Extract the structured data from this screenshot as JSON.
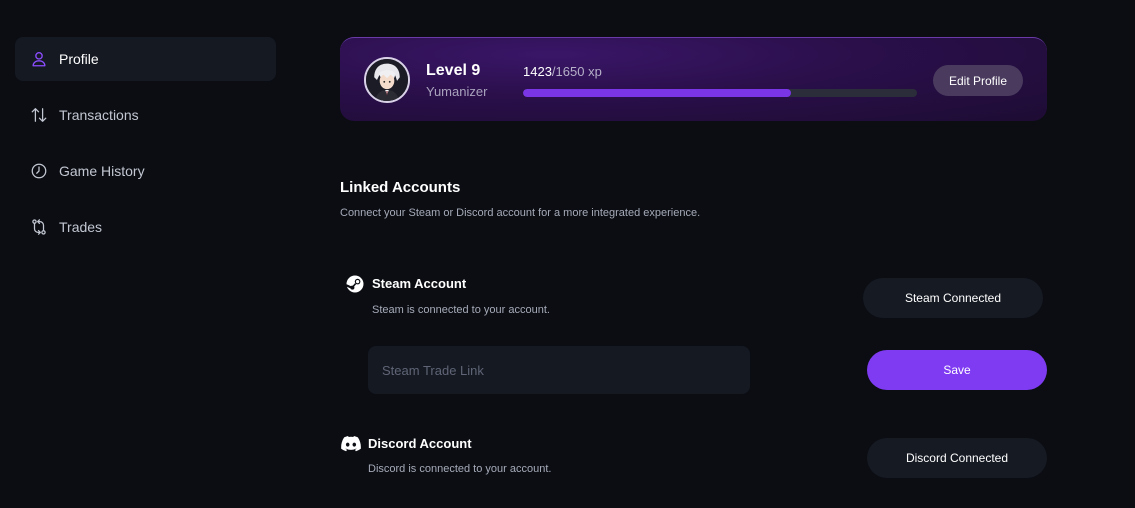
{
  "sidebar": {
    "items": [
      {
        "label": "Profile",
        "icon": "user-icon",
        "active": true
      },
      {
        "label": "Transactions",
        "icon": "arrows-up-down-icon",
        "active": false
      },
      {
        "label": "Game History",
        "icon": "clock-icon",
        "active": false
      },
      {
        "label": "Trades",
        "icon": "trade-swap-icon",
        "active": false
      }
    ]
  },
  "profile": {
    "level": "Level 9",
    "username": "Yumanizer",
    "xp_current": "1423",
    "xp_max": "/1650 xp",
    "xp_progress": 0.68,
    "edit_label": "Edit Profile"
  },
  "linked": {
    "title": "Linked Accounts",
    "subtitle": "Connect your Steam or Discord account for a more integrated experience.",
    "steam": {
      "title": "Steam Account",
      "status": "Steam is connected to your account.",
      "button": "Steam Connected",
      "trade_placeholder": "Steam Trade Link",
      "save_label": "Save"
    },
    "discord": {
      "title": "Discord Account",
      "status": "Discord is connected to your account.",
      "button": "Discord Connected"
    }
  },
  "colors": {
    "accent": "#7e3bf2",
    "background": "#0b0d13",
    "surface": "#151922"
  }
}
